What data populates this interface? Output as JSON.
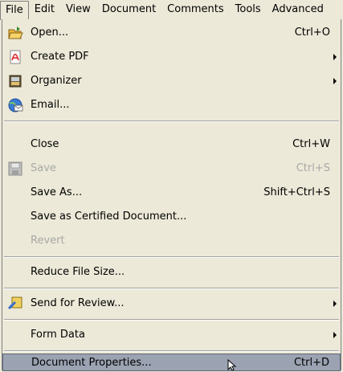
{
  "menubar": {
    "items": [
      {
        "label": "File"
      },
      {
        "label": "Edit"
      },
      {
        "label": "View"
      },
      {
        "label": "Document"
      },
      {
        "label": "Comments"
      },
      {
        "label": "Tools"
      },
      {
        "label": "Advanced"
      }
    ]
  },
  "menu": {
    "items": [
      {
        "label": "Open...",
        "shortcut": "Ctrl+O",
        "icon": "folder-open-icon"
      },
      {
        "label": "Create PDF",
        "icon": "pdf-icon",
        "submenu": true
      },
      {
        "label": "Organizer",
        "icon": "organizer-icon",
        "submenu": true
      },
      {
        "label": "Email...",
        "icon": "email-icon"
      },
      {
        "label": "Close",
        "shortcut": "Ctrl+W"
      },
      {
        "label": "Save",
        "shortcut": "Ctrl+S",
        "icon": "save-icon",
        "disabled": true
      },
      {
        "label": "Save As...",
        "shortcut": "Shift+Ctrl+S"
      },
      {
        "label": "Save as Certified Document..."
      },
      {
        "label": "Revert",
        "disabled": true
      },
      {
        "label": "Reduce File Size..."
      },
      {
        "label": "Send for Review...",
        "icon": "send-review-icon",
        "submenu": true
      },
      {
        "label": "Form Data",
        "submenu": true
      },
      {
        "label": "Document Properties...",
        "shortcut": "Ctrl+D",
        "highlighted": true
      }
    ]
  },
  "colors": {
    "menu_bg": "#ece9d8",
    "highlight": "#9ba3b2",
    "disabled_text": "#a8a8a8"
  }
}
